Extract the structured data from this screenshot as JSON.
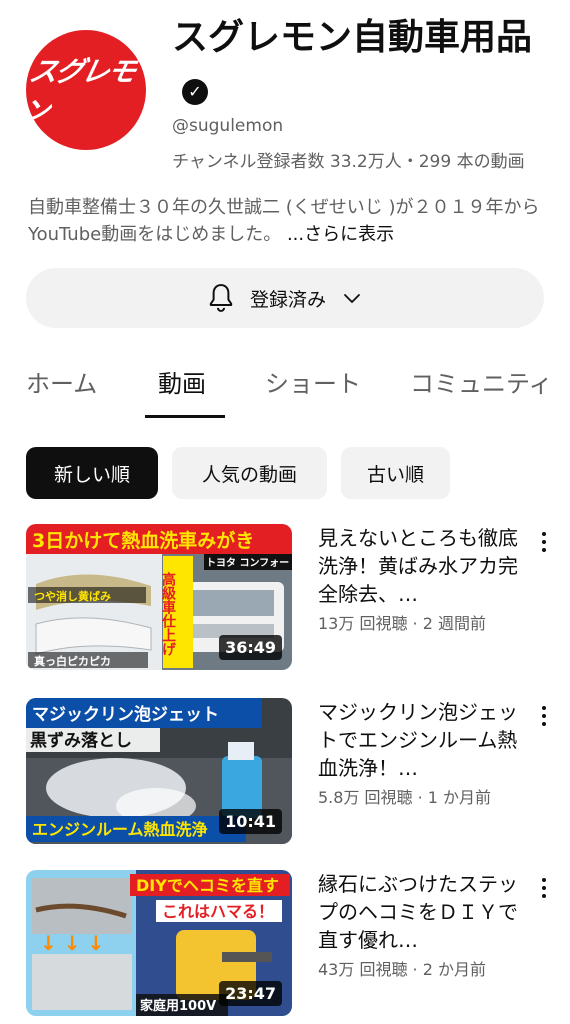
{
  "channel": {
    "avatar_text": "スグレモン",
    "name": "スグレモン自動車用品",
    "verified": "✓",
    "handle": "@sugulemon",
    "stats": "チャンネル登録者数 33.2万人・299 本の動画",
    "description": "自動車整備士３０年の久世誠二 (くぜせいじ )が２０１９年から YouTube動画をはじめました。",
    "more_label": "...さらに表示"
  },
  "subscribe": {
    "label": "登録済み"
  },
  "tabs": [
    "ホーム",
    "動画",
    "ショート",
    "コミュニティ"
  ],
  "chips": [
    "新しい順",
    "人気の動画",
    "古い順"
  ],
  "videos": [
    {
      "title": "見えないところも徹底洗浄！黄ばみ水アカ完全除去、…",
      "meta": "13万 回視聴 · 2 週間前",
      "duration": "36:49",
      "thumb_banner": "3日かけて熱血洗車みがき",
      "thumb_side": "高級車仕上げ",
      "thumb_car": "トヨタ コンフォート",
      "thumb_caption1": "つや消し黄ばみ",
      "thumb_caption2": "真っ白ピカピカ"
    },
    {
      "title": "マジックリン泡ジェットでエンジンルーム熱血洗浄！…",
      "meta": "5.8万 回視聴 · 1 か月前",
      "duration": "10:41",
      "thumb_banner": "マジックリン泡ジェット",
      "thumb_sub": "黒ずみ落とし",
      "thumb_bottom": "エンジンルーム熱血洗浄"
    },
    {
      "title": "縁石にぶつけたステップのヘコミをＤＩＹで直す優れ…",
      "meta": "43万 回視聴 · 2 か月前",
      "duration": "23:47",
      "thumb_banner": "DIYでヘコミを直す",
      "thumb_sub": "これはハマる！",
      "thumb_bottom": "家庭用100V"
    }
  ],
  "colors": {
    "brand_red": "#e31f24",
    "text_primary": "#0f0f0f",
    "text_secondary": "#606060",
    "chip_bg": "#f2f2f2"
  }
}
